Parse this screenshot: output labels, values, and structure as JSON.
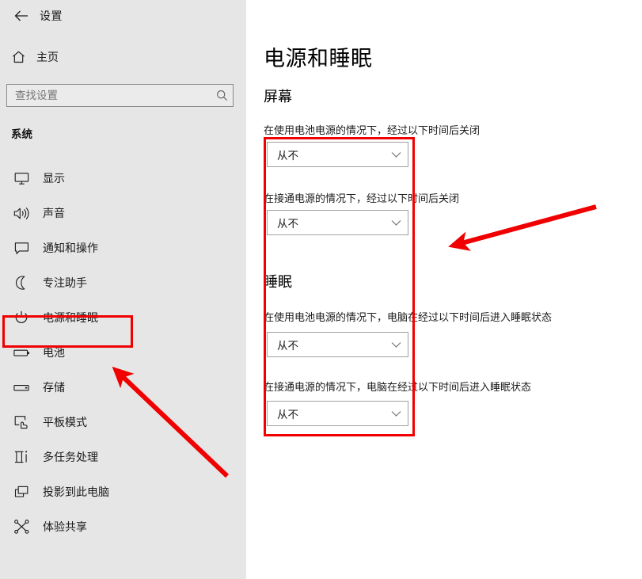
{
  "window": {
    "title": "设置",
    "back_icon": "back-arrow-icon"
  },
  "sidebar": {
    "home": {
      "label": "主页",
      "icon": "home-icon"
    },
    "search": {
      "placeholder": "查找设置",
      "value": "",
      "icon": "search-icon"
    },
    "group_title": "系统",
    "items": [
      {
        "label": "显示",
        "icon": "monitor-icon",
        "selected": false
      },
      {
        "label": "声音",
        "icon": "speaker-icon",
        "selected": false
      },
      {
        "label": "通知和操作",
        "icon": "notification-icon",
        "selected": false
      },
      {
        "label": "专注助手",
        "icon": "moon-icon",
        "selected": false
      },
      {
        "label": "电源和睡眠",
        "icon": "power-icon",
        "selected": true
      },
      {
        "label": "电池",
        "icon": "battery-icon",
        "selected": false
      },
      {
        "label": "存储",
        "icon": "storage-icon",
        "selected": false
      },
      {
        "label": "平板模式",
        "icon": "tablet-icon",
        "selected": false
      },
      {
        "label": "多任务处理",
        "icon": "multitask-icon",
        "selected": false
      },
      {
        "label": "投影到此电脑",
        "icon": "project-icon",
        "selected": false
      },
      {
        "label": "体验共享",
        "icon": "share-icon",
        "selected": false
      }
    ]
  },
  "main": {
    "page_title": "电源和睡眠",
    "sections": [
      {
        "heading": "屏幕",
        "fields": [
          {
            "label": "在使用电池电源的情况下，经过以下时间后关闭",
            "value": "从不",
            "chevron": "chevron-down-icon"
          },
          {
            "label": "在接通电源的情况下，经过以下时间后关闭",
            "value": "从不",
            "chevron": "chevron-down-icon"
          }
        ]
      },
      {
        "heading": "睡眠",
        "fields": [
          {
            "label": "在使用电池电源的情况下，电脑在经过以下时间后进入睡眠状态",
            "value": "从不",
            "chevron": "chevron-down-icon"
          },
          {
            "label": "在接通电源的情况下，电脑在经过以下时间后进入睡眠状态",
            "value": "从不",
            "chevron": "chevron-down-icon"
          }
        ]
      }
    ]
  },
  "annotations": {
    "color": "#f00000",
    "highlight_boxes": [
      {
        "name": "sidebar-power-sleep-highlight"
      },
      {
        "name": "main-dropdowns-highlight"
      }
    ],
    "arrows": [
      {
        "name": "arrow-to-main-dropdowns"
      },
      {
        "name": "arrow-to-sidebar-item"
      }
    ]
  }
}
